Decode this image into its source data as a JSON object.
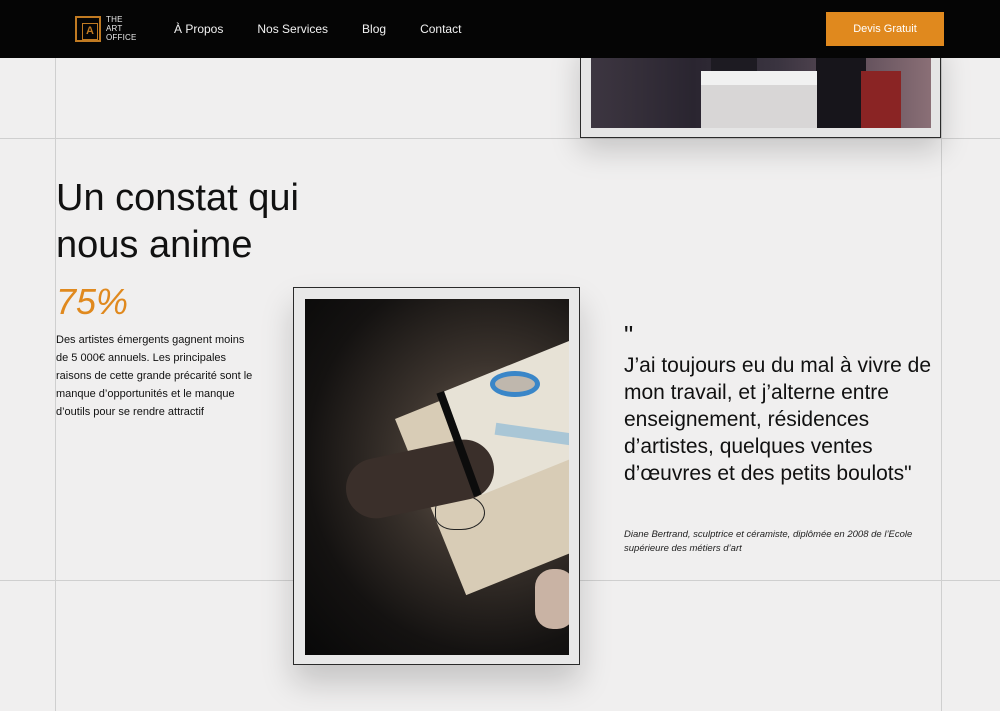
{
  "header": {
    "logo": {
      "mark_letter": "A",
      "lines": [
        "THE",
        "ART",
        "OFFICE"
      ]
    },
    "nav": [
      {
        "label": "À Propos"
      },
      {
        "label": "Nos Services"
      },
      {
        "label": "Blog"
      },
      {
        "label": "Contact"
      }
    ],
    "cta_label": "Devis Gratuit"
  },
  "section": {
    "title_line1": "Un constat qui",
    "title_line2": "nous anime",
    "stat_value": "75%",
    "stat_description": "Des artistes émergents gagnent moins de 5 000€ annuels. Les principales raisons de cette grande précarité sont le manque d’opportunités et le manque d’outils pour se rendre attractif"
  },
  "quote": {
    "mark": "\"",
    "text": "J’ai toujours eu du mal à vivre de mon travail, et j’alterne entre enseignement, résidences d’artistes, quelques ventes d’œuvres et des petits boulots\"",
    "citation": "Diane Bertrand, sculptrice et céramiste, diplômée en 2008 de l’Ecole supérieure des métiers d’art"
  },
  "colors": {
    "accent": "#e0891e",
    "header_bg": "#050505",
    "page_bg": "#f0efef"
  }
}
